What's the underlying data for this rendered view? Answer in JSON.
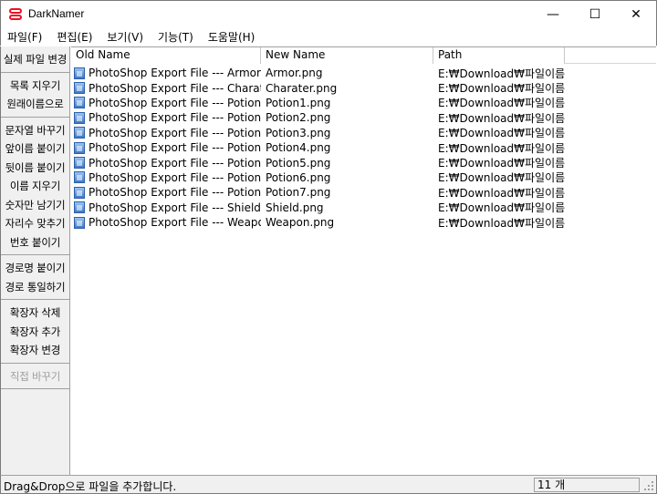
{
  "window": {
    "title": "DarkNamer",
    "minimize_glyph": "—",
    "maximize_glyph": "☐",
    "close_glyph": "✕",
    "accent": "#e81123"
  },
  "menu": [
    "파일(F)",
    "편집(E)",
    "보기(V)",
    "기능(T)",
    "도움말(H)"
  ],
  "sidebar": {
    "groups": [
      {
        "items": [
          {
            "label": "실제 파일 변경",
            "enabled": true
          }
        ]
      },
      {
        "items": [
          {
            "label": "목록 지우기",
            "enabled": true
          },
          {
            "label": "원래이름으로",
            "enabled": true
          }
        ]
      },
      {
        "items": [
          {
            "label": "문자열 바꾸기",
            "enabled": true
          },
          {
            "label": "앞이름 붙이기",
            "enabled": true
          },
          {
            "label": "뒷이름 붙이기",
            "enabled": true
          },
          {
            "label": "이름 지우기",
            "enabled": true
          },
          {
            "label": "숫자만 남기기",
            "enabled": true
          },
          {
            "label": "자리수 맞추기",
            "enabled": true
          },
          {
            "label": "번호 붙이기",
            "enabled": true
          }
        ]
      },
      {
        "items": [
          {
            "label": "경로명 붙이기",
            "enabled": true
          },
          {
            "label": "경로 통일하기",
            "enabled": true
          }
        ]
      },
      {
        "items": [
          {
            "label": "확장자 삭제",
            "enabled": true
          },
          {
            "label": "확장자 추가",
            "enabled": true
          },
          {
            "label": "확장자 변경",
            "enabled": true
          }
        ]
      },
      {
        "items": [
          {
            "label": "직접 바꾸기",
            "enabled": false
          }
        ]
      }
    ]
  },
  "table": {
    "columns": [
      "Old Name",
      "New Name",
      "Path"
    ],
    "rows": [
      {
        "old": "PhotoShop Export File --- Armor....",
        "new": "Armor.png",
        "path": "E:₩Download₩파일이름"
      },
      {
        "old": "PhotoShop Export File --- Charate...",
        "new": "Charater.png",
        "path": "E:₩Download₩파일이름"
      },
      {
        "old": "PhotoShop Export File --- Potion...",
        "new": "Potion1.png",
        "path": "E:₩Download₩파일이름"
      },
      {
        "old": "PhotoShop Export File --- Potion...",
        "new": "Potion2.png",
        "path": "E:₩Download₩파일이름"
      },
      {
        "old": "PhotoShop Export File --- Potion...",
        "new": "Potion3.png",
        "path": "E:₩Download₩파일이름"
      },
      {
        "old": "PhotoShop Export File --- Potion...",
        "new": "Potion4.png",
        "path": "E:₩Download₩파일이름"
      },
      {
        "old": "PhotoShop Export File --- Potion...",
        "new": "Potion5.png",
        "path": "E:₩Download₩파일이름"
      },
      {
        "old": "PhotoShop Export File --- Potion...",
        "new": "Potion6.png",
        "path": "E:₩Download₩파일이름"
      },
      {
        "old": "PhotoShop Export File --- Potion...",
        "new": "Potion7.png",
        "path": "E:₩Download₩파일이름"
      },
      {
        "old": "PhotoShop Export File --- Shield....",
        "new": "Shield.png",
        "path": "E:₩Download₩파일이름"
      },
      {
        "old": "PhotoShop Export File --- Weapo...",
        "new": "Weapon.png",
        "path": "E:₩Download₩파일이름"
      }
    ]
  },
  "status": {
    "message": "Drag&Drop으로 파일을 추가합니다.",
    "count": "11 개"
  }
}
